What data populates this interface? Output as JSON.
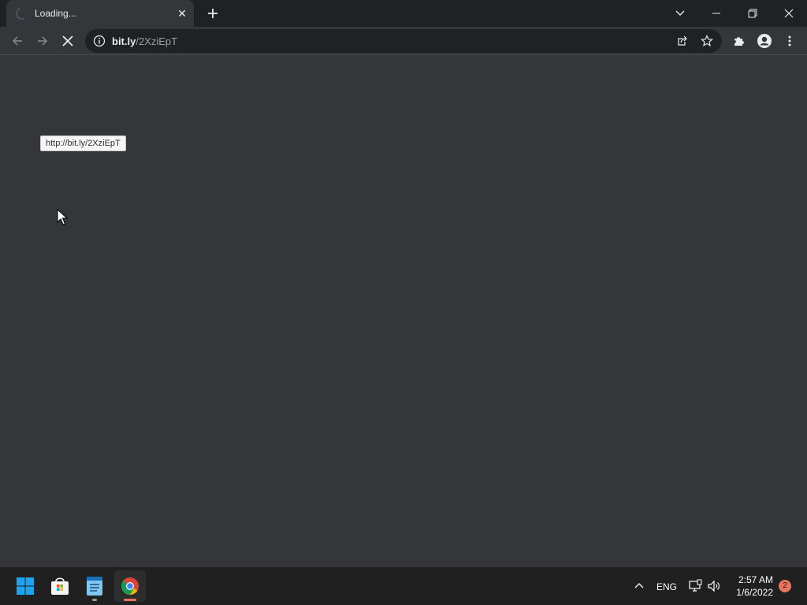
{
  "browser": {
    "tab": {
      "title": "Loading...",
      "close_glyph": "✕"
    },
    "address": {
      "host": "bit.ly",
      "path": "/2XziEpT"
    }
  },
  "page": {
    "tooltip": "http://bit.ly/2XziEpT"
  },
  "taskbar": {
    "language": "ENG",
    "time": "2:57 AM",
    "date": "1/6/2022",
    "notification_count": "2"
  },
  "colors": {
    "accent_chrome_active": "#e8745c",
    "windows_blue": "#1fa3f1"
  }
}
